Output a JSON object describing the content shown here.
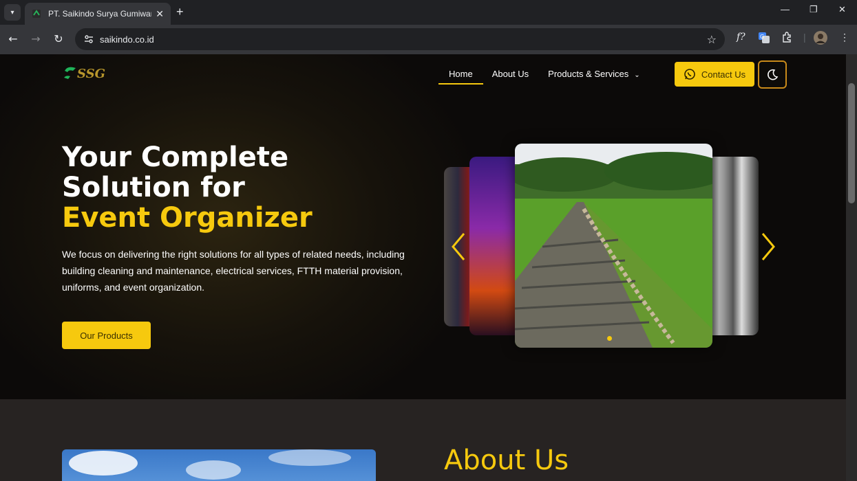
{
  "browser": {
    "tab_title": "PT. Saikindo Surya Gumiwang -",
    "url": "saikindo.co.id",
    "new_tab": "+",
    "close": "✕"
  },
  "nav": {
    "logo_text": "SSG",
    "links": [
      "Home",
      "About Us",
      "Products & Services"
    ],
    "active": "Home",
    "contact_label": "Contact Us"
  },
  "hero": {
    "title_line1": "Your Complete Solution for",
    "title_accent": "Event Organizer",
    "description": "We focus on delivering the right solutions for all types of related needs, including building cleaning and maintenance, electrical services, FTTH material provision, uniforms, and event organization.",
    "cta_label": "Our Products"
  },
  "carousel": {
    "slides": [
      "stage-lights",
      "concert-hall",
      "garden-path",
      "scaffold-worker"
    ],
    "active_index": 2
  },
  "about": {
    "title": "About Us"
  },
  "colors": {
    "accent": "#f6c90e",
    "hero_bg": "#0f0d0c",
    "about_bg": "#272322"
  }
}
